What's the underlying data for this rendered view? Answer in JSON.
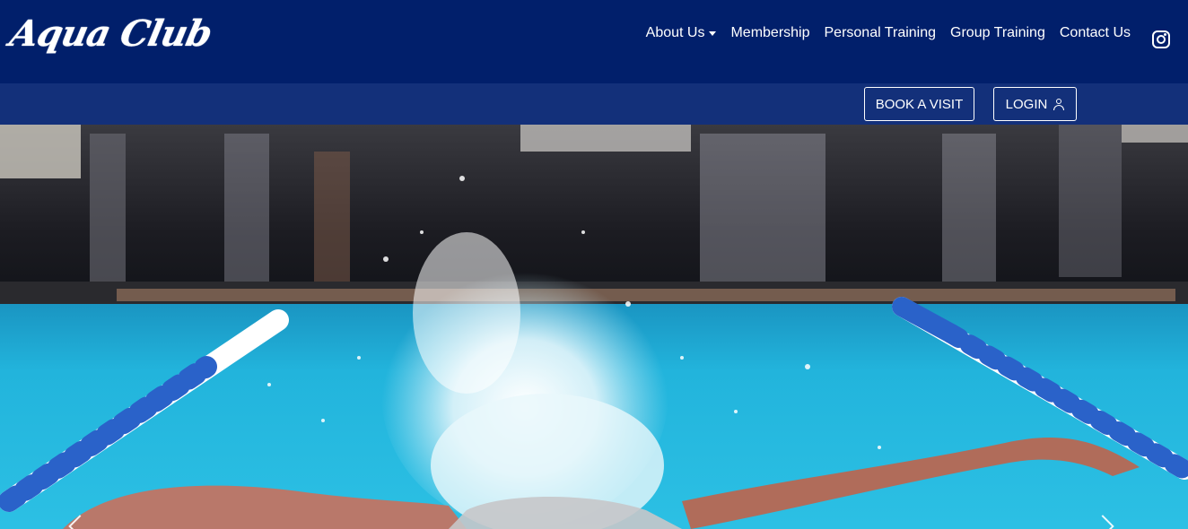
{
  "brand": {
    "logo_text": "Aqua Club"
  },
  "nav": {
    "items": [
      {
        "label": "About Us",
        "has_dropdown": true
      },
      {
        "label": "Membership"
      },
      {
        "label": "Personal Training"
      },
      {
        "label": "Group Training"
      },
      {
        "label": "Contact Us"
      }
    ],
    "social_icon": "instagram-icon"
  },
  "actions": {
    "book_label": "BOOK A VISIT",
    "login_label": "LOGIN",
    "login_icon": "user-icon"
  },
  "hero": {
    "image": "swimmer-butterfly-stroke",
    "prev_icon": "chevron-left-icon",
    "next_icon": "chevron-right-icon"
  },
  "colors": {
    "header_bg": "#011f6b",
    "subbar_bg": "#13307a",
    "text": "#ffffff",
    "pool": "#1fb0d6"
  }
}
